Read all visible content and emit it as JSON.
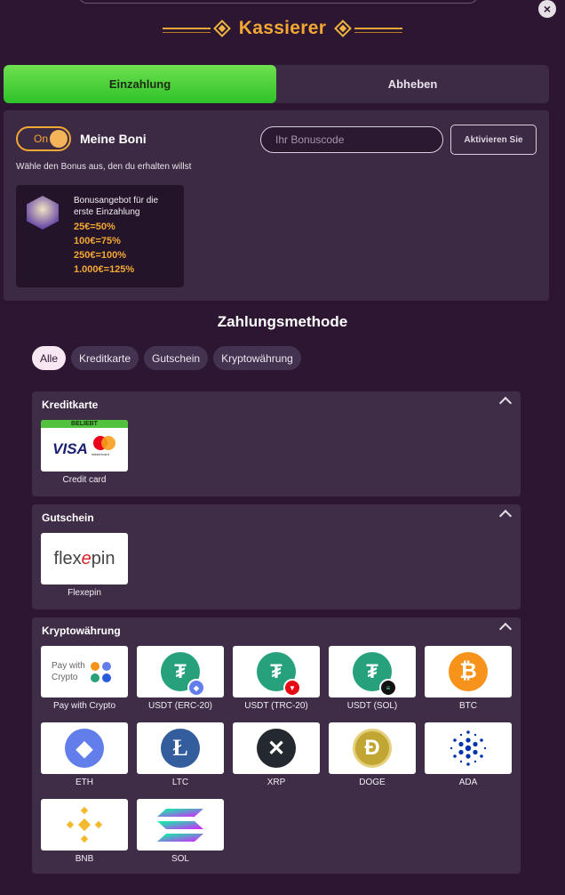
{
  "header": {
    "title": "Kassierer",
    "close_symbol": "×"
  },
  "tabs": [
    {
      "label": "Einzahlung",
      "active": true
    },
    {
      "label": "Abheben",
      "active": false
    }
  ],
  "bonus": {
    "toggle_label": "On",
    "toggle_on": true,
    "heading": "Meine Boni",
    "instruction": "Wähle den Bonus aus, den du erhalten willst",
    "code_placeholder": "Ihr Bonuscode",
    "activate_label": "Aktivieren Sie",
    "offer": {
      "title": "Bonusangebot für die erste Einzahlung",
      "lines": [
        "25€=50%",
        "100€=75%",
        "250€=100%",
        "1.000€=125%"
      ]
    }
  },
  "payment": {
    "title": "Zahlungsmethode",
    "filters": [
      {
        "label": "Alle",
        "active": true
      },
      {
        "label": "Kreditkarte",
        "active": false
      },
      {
        "label": "Gutschein",
        "active": false
      },
      {
        "label": "Kryptowährung",
        "active": false
      }
    ],
    "groups": {
      "card": {
        "heading": "Kreditkarte",
        "items": [
          {
            "caption": "Credit card",
            "badge": "BELIEBT",
            "visa": "VISA",
            "mc_text": "mastercard",
            "icon": "visa-mastercard-icon"
          }
        ]
      },
      "voucher": {
        "heading": "Gutschein",
        "items": [
          {
            "caption": "Flexepin",
            "logo_a": "flex",
            "logo_b": "e",
            "logo_c": "pin",
            "icon": "flexepin-icon"
          }
        ]
      },
      "crypto": {
        "heading": "Kryptowährung",
        "items": [
          {
            "caption": "Pay with Crypto",
            "line1": "Pay with",
            "line2": "Crypto",
            "icon": "pay-with-crypto-icon"
          },
          {
            "caption": "USDT (ERC-20)",
            "icon": "usdt-erc20-icon"
          },
          {
            "caption": "USDT (TRC-20)",
            "icon": "usdt-trc20-icon"
          },
          {
            "caption": "USDT (SOL)",
            "icon": "usdt-sol-icon"
          },
          {
            "caption": "BTC",
            "icon": "btc-icon"
          },
          {
            "caption": "ETH",
            "icon": "eth-icon"
          },
          {
            "caption": "LTC",
            "icon": "ltc-icon"
          },
          {
            "caption": "XRP",
            "icon": "xrp-icon"
          },
          {
            "caption": "DOGE",
            "icon": "doge-icon"
          },
          {
            "caption": "ADA",
            "icon": "ada-icon"
          },
          {
            "caption": "BNB",
            "icon": "bnb-icon"
          },
          {
            "caption": "SOL",
            "icon": "sol-icon"
          }
        ]
      }
    }
  },
  "colors": {
    "background": "#2c1632",
    "accent": "#f3a833",
    "active_tab": "#3ccf32",
    "panel": "#3f2d48"
  }
}
